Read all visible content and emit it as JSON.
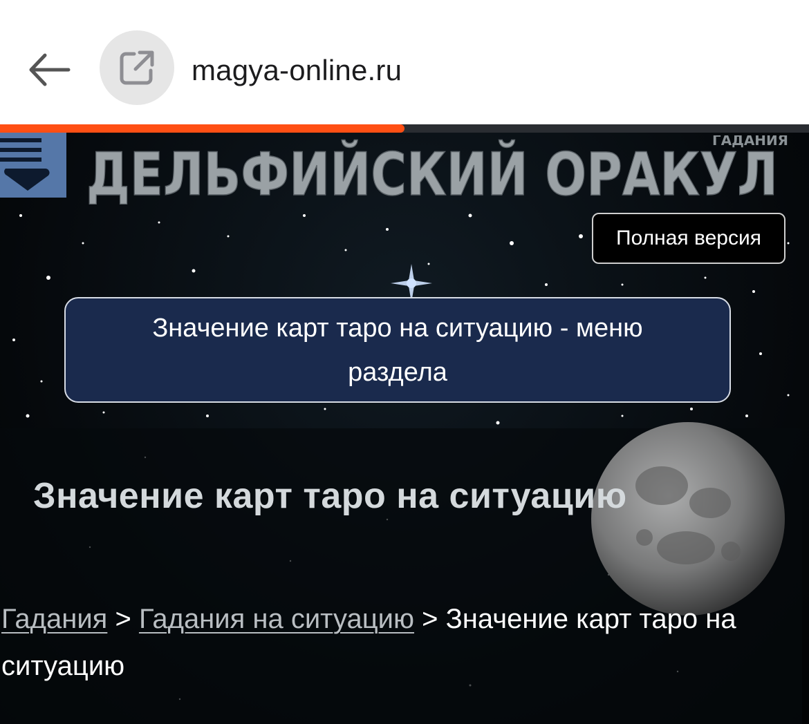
{
  "browser": {
    "url": "magya-online.ru",
    "progress_fraction": 0.5,
    "accent_color": "#ff4f14",
    "back_icon": "back-arrow-icon",
    "site_icon": "external-link-icon"
  },
  "site": {
    "logo_title": "ДЕЛЬФИЙСКИЙ ОРАКУЛ",
    "logo_tag": "ГАДАНИЯ",
    "menu_icon": "menu-toggle-icon",
    "full_version_label": "Полная версия",
    "section_menu_label": "Значение карт таро на ситуацию - меню раздела"
  },
  "content": {
    "heading": "Значение карт таро на ситуацию",
    "breadcrumb": {
      "link1": "Гадания",
      "sep1": " > ",
      "link2": "Гадания на ситуацию",
      "sep2": " > ",
      "current": "Значение карт таро на ситуацию"
    }
  },
  "colors": {
    "menu_button": "#5577a8",
    "section_button": "#1a2a4d"
  }
}
